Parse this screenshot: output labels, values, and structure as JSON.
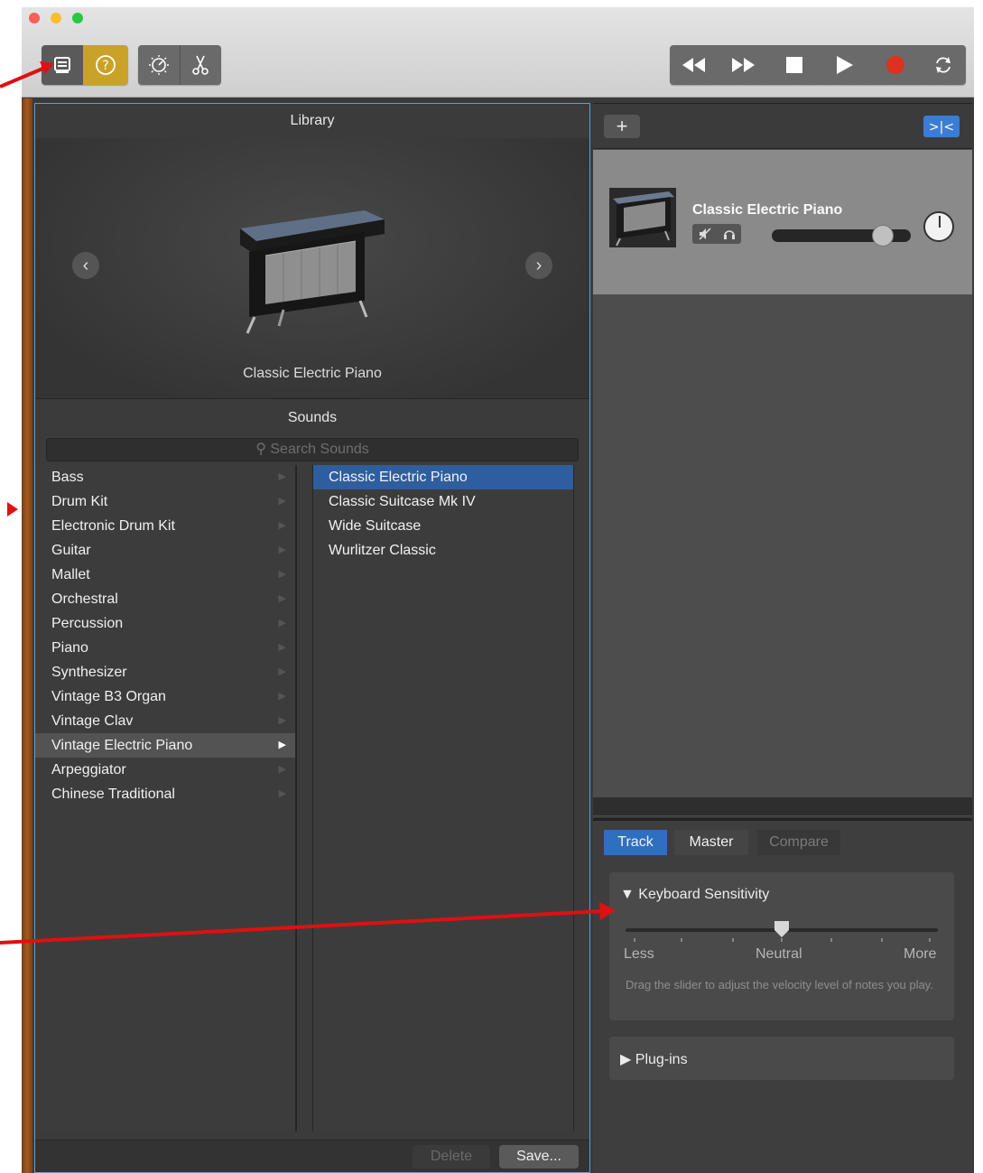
{
  "toolbar": {
    "library_button": "library-icon",
    "help_button": "help-icon",
    "smart_controls_button": "smart-controls-icon",
    "editors_button": "scissors-icon",
    "transport": [
      "rewind-icon",
      "fast-forward-icon",
      "stop-icon",
      "play-icon",
      "record-icon",
      "cycle-icon"
    ],
    "accent_yellow": "#c9a227",
    "record_red": "#e03020"
  },
  "library": {
    "header": "Library",
    "preview_name": "Classic Electric Piano",
    "sounds_header": "Sounds",
    "search_placeholder": "Search Sounds",
    "categories": [
      {
        "label": "Bass"
      },
      {
        "label": "Drum Kit"
      },
      {
        "label": "Electronic Drum Kit"
      },
      {
        "label": "Guitar"
      },
      {
        "label": "Mallet"
      },
      {
        "label": "Orchestral"
      },
      {
        "label": "Percussion"
      },
      {
        "label": "Piano"
      },
      {
        "label": "Synthesizer"
      },
      {
        "label": "Vintage B3 Organ"
      },
      {
        "label": "Vintage Clav"
      },
      {
        "label": "Vintage Electric Piano",
        "selected": true
      },
      {
        "label": "Arpeggiator"
      },
      {
        "label": "Chinese Traditional"
      }
    ],
    "sounds": [
      {
        "label": "Classic Electric Piano",
        "selected": true
      },
      {
        "label": "Classic Suitcase Mk IV"
      },
      {
        "label": "Wide Suitcase"
      },
      {
        "label": "Wurlitzer Classic"
      }
    ],
    "delete_label": "Delete",
    "save_label": "Save...",
    "selection_color": "#2f5e9e"
  },
  "tracks": {
    "add_label": "+",
    "track_name": "Classic Electric Piano",
    "volume_level": 0.8
  },
  "smart_controls": {
    "tabs": [
      {
        "label": "Track",
        "active": true
      },
      {
        "label": "Master"
      },
      {
        "label": "Compare",
        "disabled": true
      }
    ],
    "section_title": "Keyboard Sensitivity",
    "slider_labels": {
      "less": "Less",
      "neutral": "Neutral",
      "more": "More"
    },
    "slider_value": 0.5,
    "description": "Drag the slider to adjust the velocity level of notes you play.",
    "plugins_title": "Plug-ins"
  }
}
